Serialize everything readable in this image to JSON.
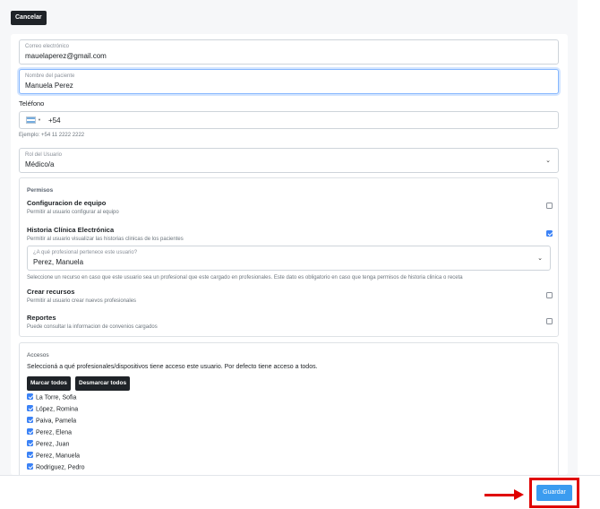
{
  "actions": {
    "cancel_label": "Cancelar",
    "save_label": "Guardar"
  },
  "form": {
    "email": {
      "label": "Correo electrónico",
      "value": "mauelaperez@gmail.com"
    },
    "patient_name": {
      "label": "Nombre del paciente",
      "value": "Manuela Perez"
    },
    "phone": {
      "label": "Teléfono",
      "country_code": "+54",
      "hint": "Ejemplo: +54 11 2222 2222"
    },
    "role": {
      "label": "Rol del Usuario",
      "value": "Médico/a"
    }
  },
  "permissions": {
    "title": "Permisos",
    "items": [
      {
        "title": "Configuracion de equipo",
        "description": "Permitir al usuario configurar al equipo",
        "checked": false
      },
      {
        "title": "Historia Clínica Electrónica",
        "description": "Permitir al usuario visualizar las historias clinicas de los pacientes",
        "checked": true
      },
      {
        "title": "Crear recursos",
        "description": "Permitir al usuario crear nuevos profesionales",
        "checked": false
      },
      {
        "title": "Reportes",
        "description": "Puede consultar la informacion de convenios cargados",
        "checked": false
      }
    ],
    "professional_select": {
      "label": "¿A qué profesional pertenece este usuario?",
      "value": "Perez, Manuela",
      "hint": "Seleccione un recurso en caso que este usuario sea un profesional que este cargado en profesionales. Este dato es obligatorio en caso que tenga permisos de historia clinica o receta"
    }
  },
  "access": {
    "title": "Accesos",
    "description": "Seleccioná a qué profesionales/dispositivos tiene acceso este usuario. Por defecto tiene acceso a todos.",
    "select_all_label": "Marcar todos",
    "deselect_all_label": "Desmarcar todos",
    "items": [
      {
        "name": "La Torre, Sofia",
        "checked": true
      },
      {
        "name": "López, Romina",
        "checked": true
      },
      {
        "name": "Paiva, Pamela",
        "checked": true
      },
      {
        "name": "Perez, Elena",
        "checked": true
      },
      {
        "name": "Perez, Juan",
        "checked": true
      },
      {
        "name": "Perez, Manuela",
        "checked": true
      },
      {
        "name": "Rodriguez, Pedro",
        "checked": true
      }
    ]
  },
  "colors": {
    "primary": "#3b9cf0",
    "dark": "#1f2328",
    "highlight": "#e00000"
  }
}
